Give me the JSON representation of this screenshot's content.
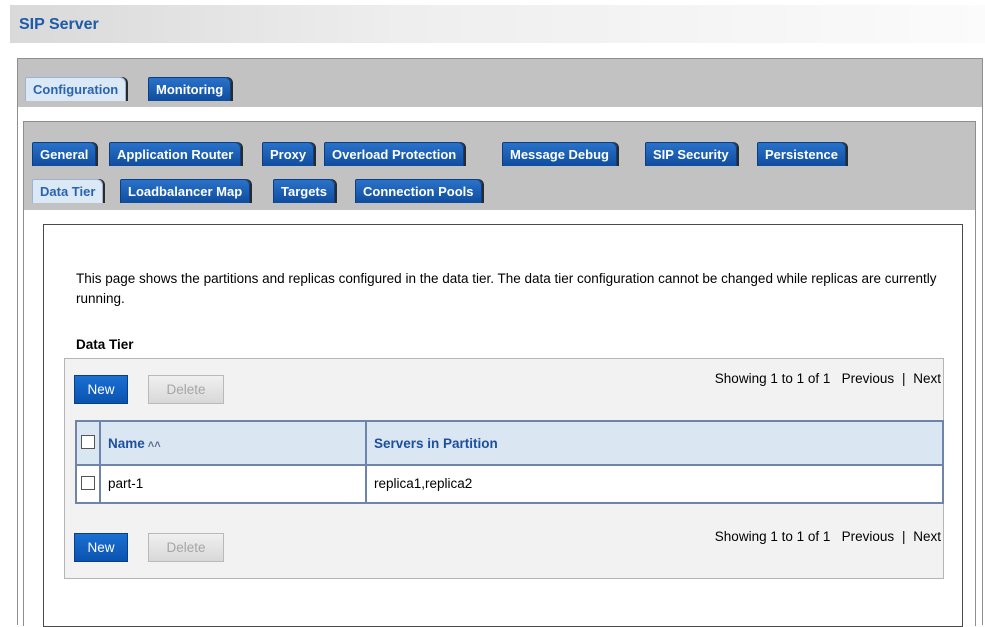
{
  "header": {
    "title": "SIP Server"
  },
  "outer_tabs": [
    {
      "label": "Configuration",
      "active": true
    },
    {
      "label": "Monitoring",
      "active": false
    }
  ],
  "inner_tabs_row1": [
    {
      "label": "General"
    },
    {
      "label": "Application Router"
    },
    {
      "label": "Proxy"
    },
    {
      "label": "Overload Protection"
    },
    {
      "label": "Message Debug"
    },
    {
      "label": "SIP Security"
    },
    {
      "label": "Persistence"
    }
  ],
  "inner_tabs_row2": [
    {
      "label": "Data Tier",
      "active": true
    },
    {
      "label": "Loadbalancer Map"
    },
    {
      "label": "Targets"
    },
    {
      "label": "Connection Pools"
    }
  ],
  "description": "This page shows the partitions and replicas configured in the data tier. The data tier configuration cannot be changed while replicas are currently running.",
  "section_title": "Data Tier",
  "buttons": {
    "new": "New",
    "delete": "Delete"
  },
  "pager": {
    "summary": "Showing 1 to 1 of 1",
    "previous": "Previous",
    "separator": "|",
    "next": "Next"
  },
  "table": {
    "columns": {
      "name": "Name",
      "servers": "Servers in Partition"
    },
    "sort_icon": "sort-ascending-icon",
    "rows": [
      {
        "name": "part-1",
        "servers": "replica1,replica2"
      }
    ]
  }
}
